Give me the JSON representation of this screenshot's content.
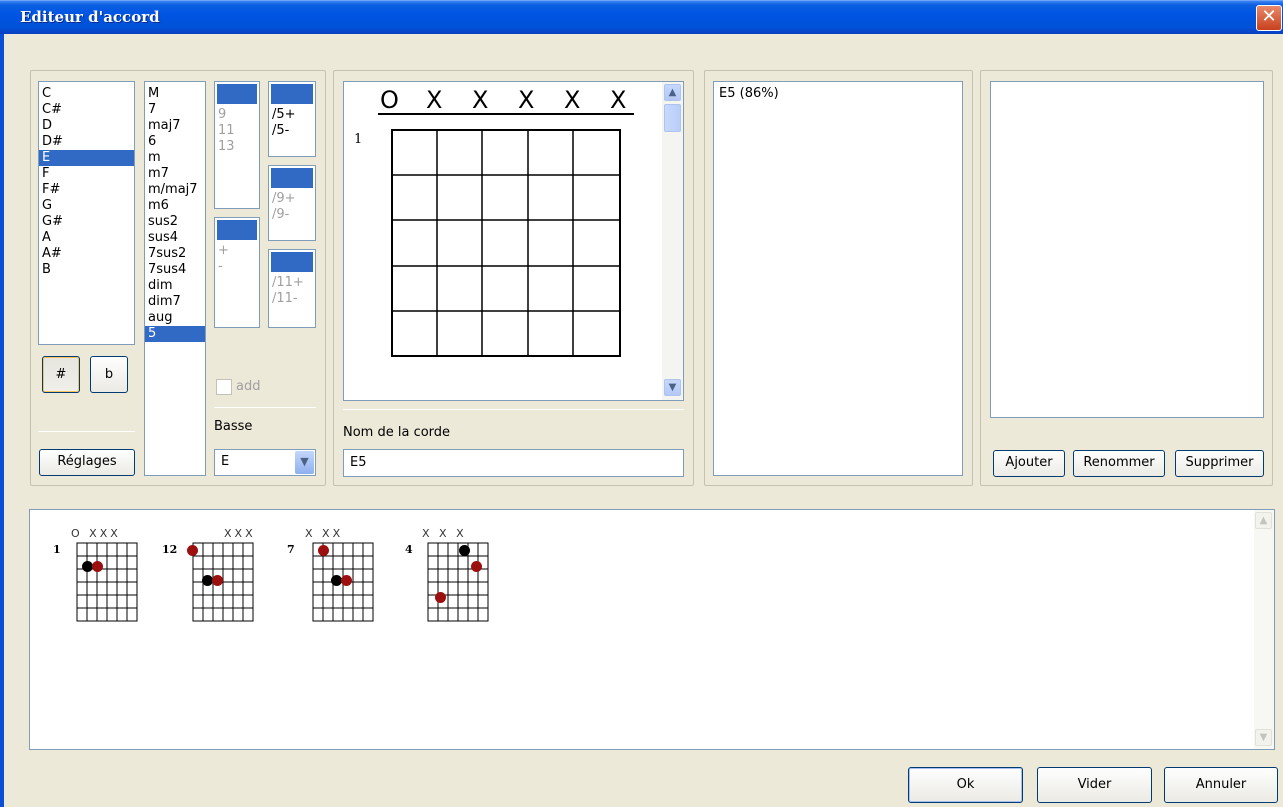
{
  "window": {
    "title": "Editeur d'accord",
    "close_icon": "close-icon"
  },
  "roots": {
    "items": [
      "C",
      "C#",
      "D",
      "D#",
      "E",
      "F",
      "F#",
      "G",
      "G#",
      "A",
      "A#",
      "B"
    ],
    "selected": "E"
  },
  "sharp_button": "#",
  "flat_button": "b",
  "settings_button": "Réglages",
  "qualities": {
    "items": [
      "M",
      "7",
      "maj7",
      "6",
      "m",
      "m7",
      "m/maj7",
      "m6",
      "sus2",
      "sus4",
      "7sus2",
      "7sus4",
      "dim",
      "dim7",
      "aug",
      "5"
    ],
    "selected": "5"
  },
  "extensions": [
    "9",
    "11",
    "13"
  ],
  "plus_minus": [
    "+",
    "-"
  ],
  "fifth_alt": [
    "/5+",
    "/5-"
  ],
  "ninth_alt": [
    "/9+",
    "/9-"
  ],
  "eleventh_alt": [
    "/11+",
    "/11-"
  ],
  "add_label": "add",
  "bass": {
    "label": "Basse",
    "value": "E"
  },
  "editor": {
    "string_marks": [
      "O",
      "X",
      "X",
      "X",
      "X",
      "X"
    ],
    "fret_number": "1",
    "name_label": "Nom de la corde",
    "name_value": "E5"
  },
  "matches": [
    "E5 (86%)"
  ],
  "library_buttons": {
    "add": "Ajouter",
    "rename": "Renommer",
    "delete": "Supprimer"
  },
  "diagrams": [
    {
      "fret": "1",
      "marks": "O XXX"
    },
    {
      "fret": "12",
      "marks": "XXX"
    },
    {
      "fret": "7",
      "marks": "X XX"
    },
    {
      "fret": "4",
      "marks": "X X X"
    }
  ],
  "footer": {
    "ok": "Ok",
    "clear": "Vider",
    "cancel": "Annuler"
  },
  "colors": {
    "selection": "#316ac5",
    "titlebar": "#0054e3",
    "dot_red": "#9c0f0f",
    "dot_black": "#000000",
    "face": "#ece9d8"
  }
}
